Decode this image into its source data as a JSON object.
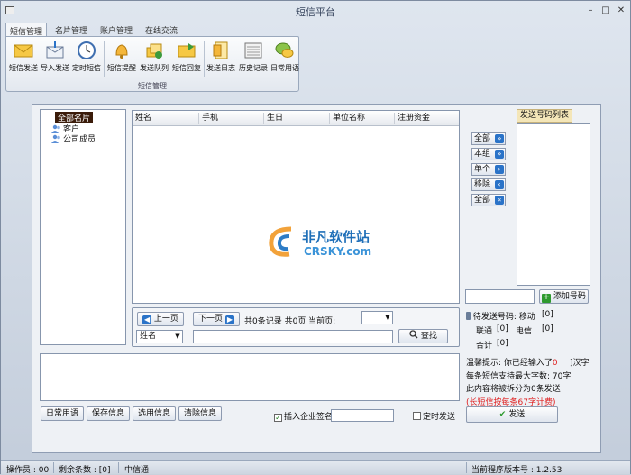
{
  "window": {
    "title": "短信平台",
    "minimize": "–",
    "maximize": "□",
    "close": "✕"
  },
  "tabs": [
    {
      "label": "短信管理",
      "active": true
    },
    {
      "label": "名片管理"
    },
    {
      "label": "账户管理"
    },
    {
      "label": "在线交流"
    }
  ],
  "ribbon": {
    "group_label": "短信管理",
    "buttons": [
      {
        "label": "短信发送",
        "icon": "envelope-icon"
      },
      {
        "label": "导入发送",
        "icon": "import-envelope-icon"
      },
      {
        "label": "定时短信",
        "icon": "clock-icon"
      },
      {
        "label": "短信提醒",
        "icon": "bell-icon"
      },
      {
        "label": "发送队列",
        "icon": "queue-icon"
      },
      {
        "label": "短信回复",
        "icon": "reply-icon"
      },
      {
        "label": "发送日志",
        "icon": "log-icon"
      },
      {
        "label": "历史记录",
        "icon": "history-icon"
      },
      {
        "label": "日常用语",
        "icon": "chat-icon"
      }
    ]
  },
  "tree": {
    "root": "全部名片",
    "children": [
      "客户",
      "公司成员"
    ]
  },
  "grid": {
    "columns": [
      "姓名",
      "手机",
      "生日",
      "单位名称",
      "注册资金"
    ]
  },
  "watermark": {
    "line1": "非凡软件站",
    "line2": "CRSKY.com"
  },
  "pager": {
    "prev": "上一页",
    "next": "下一页",
    "info": "共0条记录 共0页 当前页:",
    "search_field": "姓名",
    "search_button": "查找"
  },
  "side_buttons": [
    "全部",
    "本组",
    "单个",
    "移除",
    "全部"
  ],
  "send_list": {
    "title": "发送号码列表"
  },
  "add_number": "添加号码",
  "pending": {
    "label": "待发送号码:",
    "mobile_label": "移动",
    "mobile": "[0]",
    "unicom_label": "联通",
    "unicom": "[0]",
    "telecom_label": "电信",
    "telecom": "[0]",
    "total_label": "合计",
    "total": "[0]"
  },
  "tips": {
    "line1a": "温馨提示: 你已经输入了",
    "count": "0",
    "line1b": "]汉字",
    "line2": "每条短信支持最大字数: 70字",
    "line3": "此内容将被拆分为0条发送",
    "line4": "(长短信按每条67字计费)"
  },
  "bottom_buttons": [
    "日常用语",
    "保存信息",
    "选用信息",
    "清除信息"
  ],
  "insert_signature": {
    "label": "插入企业签名",
    "checked": true
  },
  "scheduled": {
    "label": "定时发送",
    "checked": false
  },
  "send_button": "发送",
  "status_bar": {
    "operator": "操作员 : 00",
    "remaining": "剩余条数 : [0]",
    "carrier": "中信通",
    "version": "当前程序版本号 : 1.2.53"
  },
  "colors": {
    "accent_blue": "#2a73c8",
    "tip_red": "#e02020",
    "tree_selected": "#3b1c0a"
  }
}
